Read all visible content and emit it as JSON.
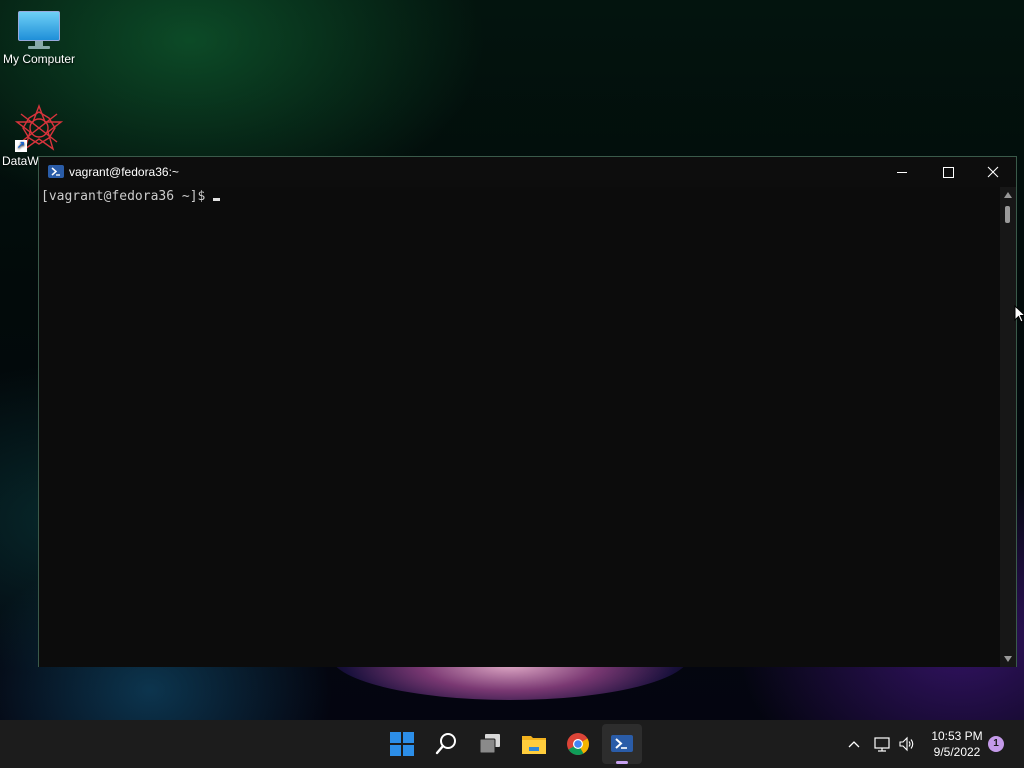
{
  "desktop": {
    "icons": [
      {
        "label": "My Computer",
        "icon": "monitor-icon"
      },
      {
        "label": "DataW",
        "icon": "datawarrior-logo-icon",
        "shortcut": true
      }
    ]
  },
  "window": {
    "title": "vagrant@fedora36:~",
    "icon": "powershell-icon",
    "controls": [
      "minimize",
      "maximize",
      "close"
    ]
  },
  "terminal": {
    "prompt": "[vagrant@fedora36 ~]$"
  },
  "taskbar": {
    "apps": [
      {
        "name": "Start",
        "icon": "windows-start-icon"
      },
      {
        "name": "Search",
        "icon": "search-icon"
      },
      {
        "name": "Task View",
        "icon": "task-view-icon"
      },
      {
        "name": "File Explorer",
        "icon": "folder-icon"
      },
      {
        "name": "Google Chrome",
        "icon": "chrome-icon"
      },
      {
        "name": "PowerShell",
        "icon": "powershell-icon",
        "active": true
      }
    ],
    "tray": {
      "time": "10:53 PM",
      "date": "9/5/2022",
      "notification_count": "1"
    }
  },
  "colors": {
    "terminal_bg": "#0c0c0c",
    "taskbar_bg": "#1c1c1c",
    "accent": "#c49ae9"
  }
}
